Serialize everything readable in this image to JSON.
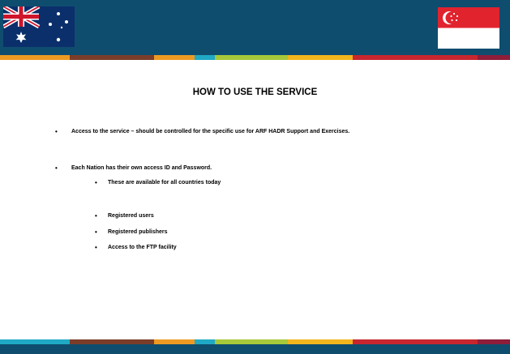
{
  "slide": {
    "title": "HOW TO USE THE SERVICE",
    "bullets": [
      "Access to the service – should be controlled for the specific use for ARF HADR Support and Exercises.",
      "Each Nation has their own access ID and Password."
    ],
    "sub_bullets": [
      "These are available for all countries today",
      "Registered users",
      "Registered publishers",
      "Access to the FTP facility"
    ],
    "bullet_glyph": "•"
  },
  "colors": {
    "header": "#0f4d6f",
    "stripe": [
      "#ee9a22",
      "#7a3d2a",
      "#ee9a22",
      "#0f4d6f",
      "#20a9c4",
      "#a7c83a",
      "#f2b51d",
      "#c8262f",
      "#8e1d3a"
    ]
  },
  "icons": {
    "left_flag": "australia-flag-icon",
    "right_flag": "singapore-flag-icon"
  }
}
